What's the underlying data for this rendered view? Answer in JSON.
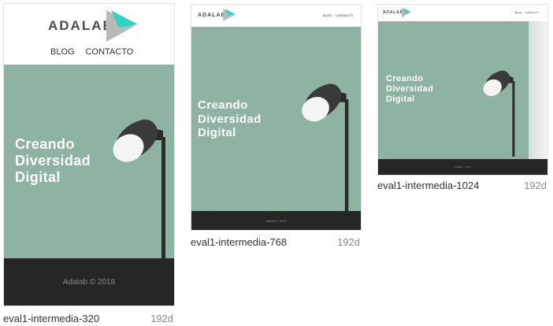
{
  "cards": [
    {
      "id": "320",
      "logo_text": "ADALAB",
      "nav": [
        "BLOG",
        "CONTACTO"
      ],
      "hero_title": "Creando\nDiversidad\nDigital",
      "footer_text": "Adalab © 2018",
      "name": "eval1-intermedia-320",
      "age": "192d"
    },
    {
      "id": "768",
      "logo_text": "ADALAB",
      "nav": [
        "BLOG",
        "CONTACTO"
      ],
      "hero_title": "Creando\nDiversidad\nDigital",
      "footer_text": "Adalab © 2018",
      "name": "eval1-intermedia-768",
      "age": "192d"
    },
    {
      "id": "1024",
      "logo_text": "ADALAB",
      "nav": [
        "BLOG",
        "CONTACTO"
      ],
      "hero_title": "Creando\nDiversidad\nDigital",
      "footer_text": "Adalab © 2018",
      "name": "eval1-intermedia-1024",
      "age": "192d"
    }
  ],
  "colors": {
    "hero_bg": "#8fb3a2",
    "footer_bg": "#262626",
    "logo_accent": "#2ed3c6",
    "logo_gray": "#b9b9b9"
  },
  "icons": [
    "logo-triangle-icon",
    "lamp-illustration"
  ]
}
